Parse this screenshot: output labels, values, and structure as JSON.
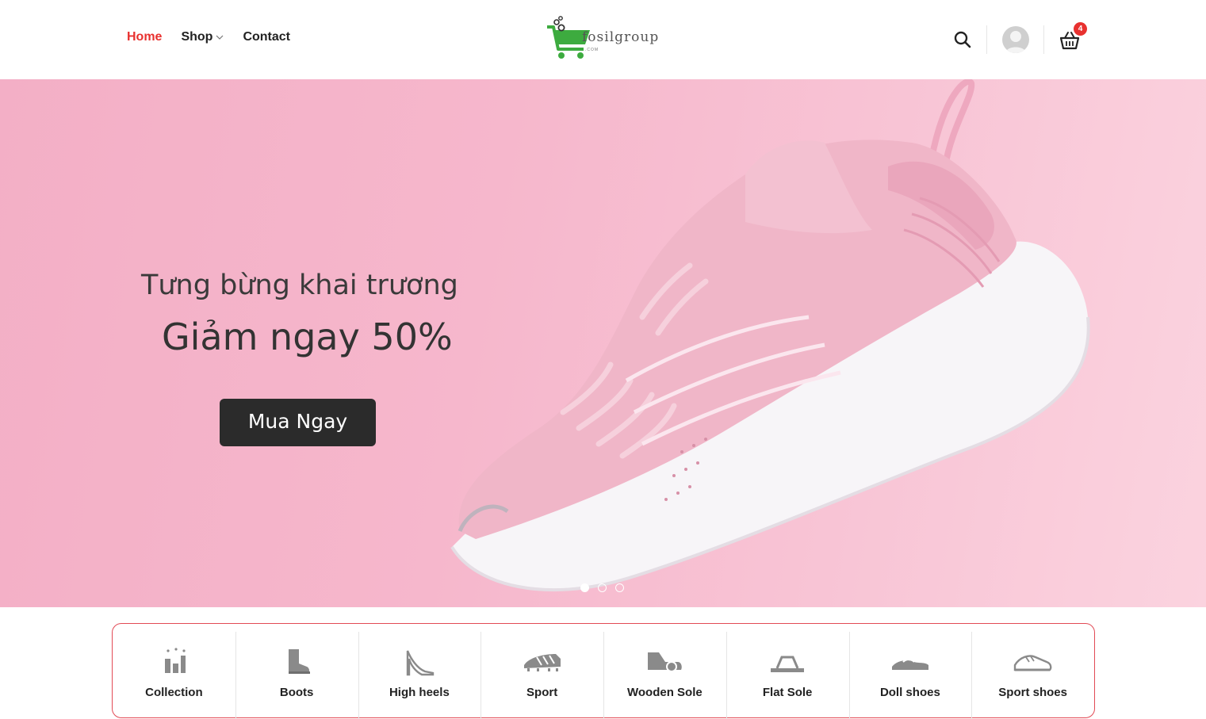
{
  "nav": {
    "home": "Home",
    "shop": "Shop",
    "contact": "Contact"
  },
  "logo": {
    "text": "fosilgroup",
    "suffix": ".COM"
  },
  "header": {
    "cart_count": "4",
    "icons": [
      "search-icon",
      "user-avatar",
      "basket-icon"
    ]
  },
  "hero": {
    "line1": "Tưng bừng khai trương",
    "line2": "Giảm ngay 50%",
    "button": "Mua Ngay",
    "slides": 3,
    "active_slide": 1
  },
  "categories": [
    {
      "label": "Collection",
      "icon": "collection-icon"
    },
    {
      "label": "Boots",
      "icon": "boot-icon"
    },
    {
      "label": "High heels",
      "icon": "high-heel-icon"
    },
    {
      "label": "Sport",
      "icon": "cleat-icon"
    },
    {
      "label": "Wooden Sole",
      "icon": "wooden-sole-icon"
    },
    {
      "label": "Flat Sole",
      "icon": "flat-sandal-icon"
    },
    {
      "label": "Doll shoes",
      "icon": "doll-shoe-icon"
    },
    {
      "label": "Sport shoes",
      "icon": "sneaker-icon"
    }
  ],
  "colors": {
    "accent": "#e8312f",
    "hero_bg": "#f6b7cc",
    "button_bg": "#2b2b2b",
    "icon_gray": "#8a8a8a",
    "logo_green": "#3dab3f"
  }
}
